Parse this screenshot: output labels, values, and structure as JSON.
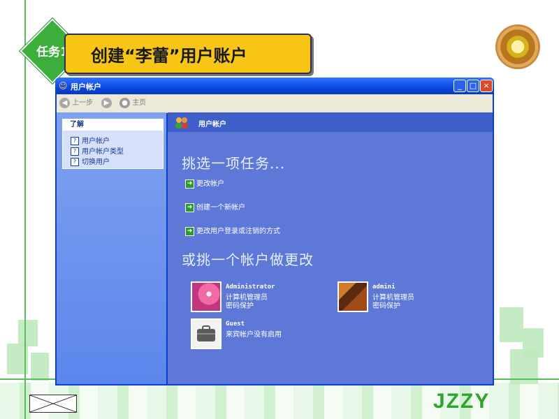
{
  "slide": {
    "task_label": "任务1",
    "title": "创建“李蕾”用户账户",
    "brand": "JZZY"
  },
  "window": {
    "title": "用户帐户",
    "controls": {
      "minimize": "_",
      "maximize": "□",
      "close": "×"
    },
    "toolbar": {
      "back_label": "上一步",
      "home_label": "主页"
    },
    "left": {
      "section_title": "了解",
      "links": [
        "用户帐户",
        "用户帐户类型",
        "切换用户"
      ]
    },
    "right": {
      "header": "用户帐户",
      "pick_task": "挑选一项任务...",
      "tasks": [
        "更改帐户",
        "创建一个新帐户",
        "更改用户登录或注销的方式"
      ],
      "or_pick": "或挑一个帐户做更改",
      "accounts": [
        {
          "name": "Administrator",
          "line1": "计算机管理员",
          "line2": "密码保护"
        },
        {
          "name": "admini",
          "line1": "计算机管理员",
          "line2": "密码保护"
        },
        {
          "name": "Guest",
          "line1": "来宾帐户没有启用",
          "line2": ""
        }
      ]
    }
  },
  "colors": {
    "accent_green": "#3cae3c",
    "title_yellow": "#f7c615",
    "xp_blue": "#0a47df",
    "pane_blue": "#5d78d6"
  },
  "icons": [
    "task-badge-icon",
    "medal-icon",
    "user-accounts-icon",
    "back-icon",
    "forward-icon",
    "home-icon",
    "help-icon",
    "arrow-icon"
  ]
}
